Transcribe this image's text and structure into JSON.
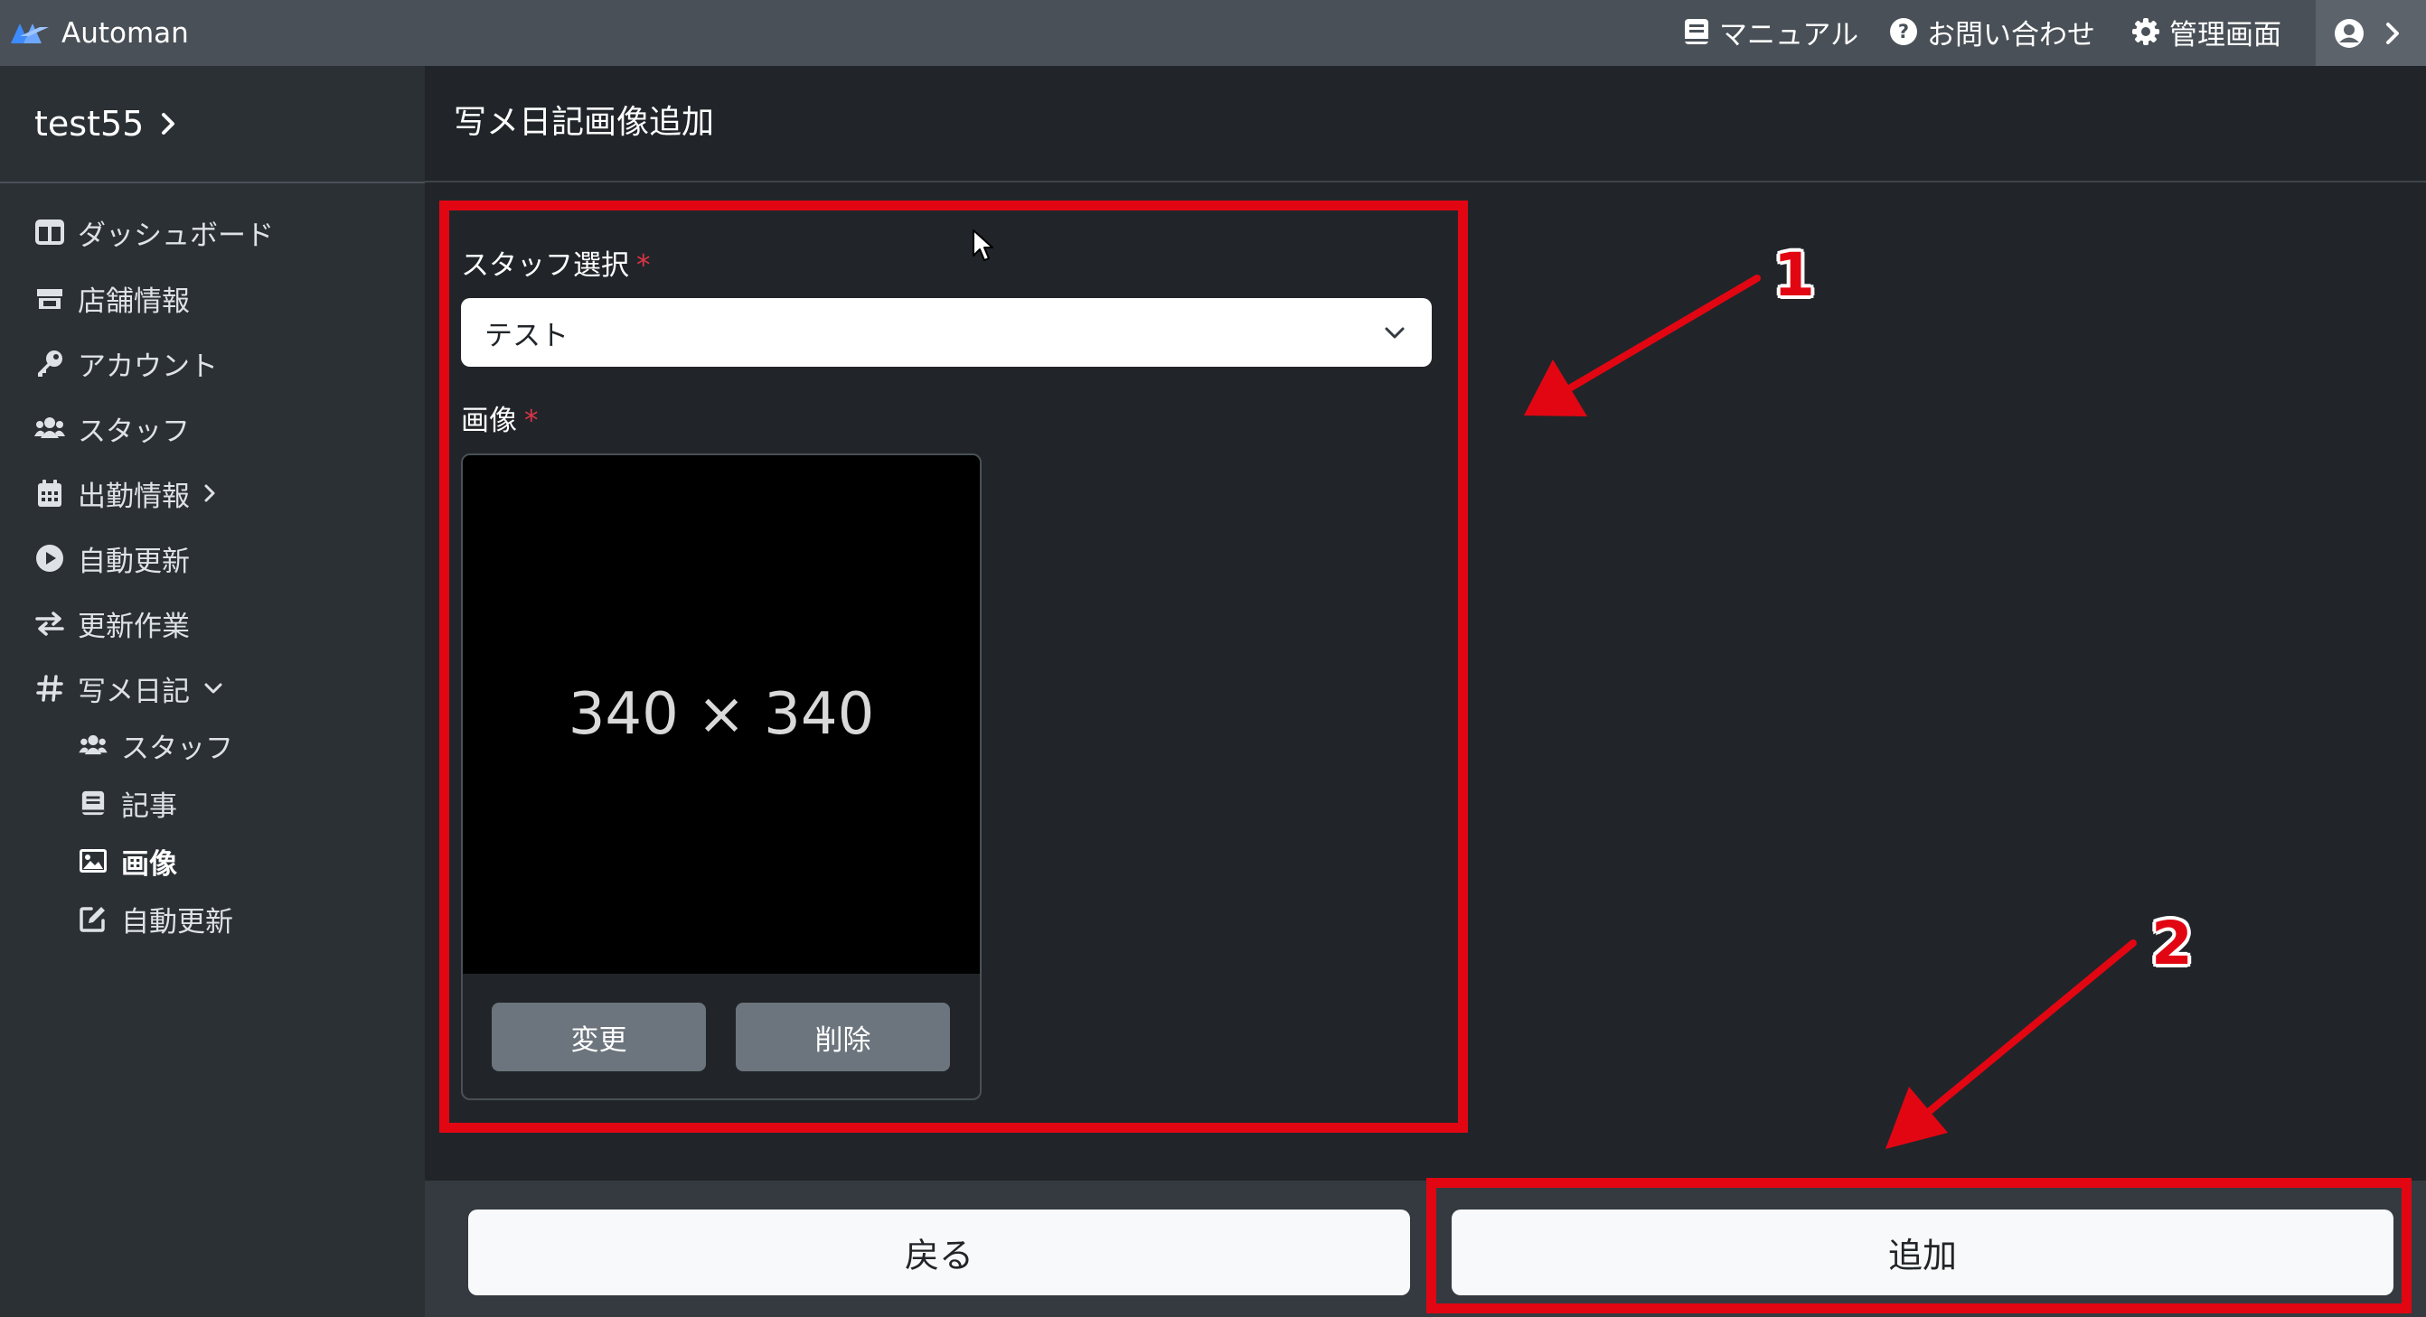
{
  "topbar": {
    "app_name": "Automan",
    "manual": "マニュアル",
    "contact": "お問い合わせ",
    "admin": "管理画面"
  },
  "sidebar": {
    "store_name": "test55",
    "items": [
      {
        "label": "ダッシュボード",
        "icon": "columns-icon"
      },
      {
        "label": "店舗情報",
        "icon": "store-icon"
      },
      {
        "label": "アカウント",
        "icon": "key-icon"
      },
      {
        "label": "スタッフ",
        "icon": "users-icon"
      },
      {
        "label": "出勤情報",
        "icon": "calendar-icon"
      },
      {
        "label": "自動更新",
        "icon": "play-circle-icon"
      },
      {
        "label": "更新作業",
        "icon": "exchange-icon"
      },
      {
        "label": "写メ日記",
        "icon": "hashtag-icon"
      }
    ],
    "sub_items": [
      {
        "label": "スタッフ",
        "icon": "users-icon"
      },
      {
        "label": "記事",
        "icon": "book-icon"
      },
      {
        "label": "画像",
        "icon": "image-icon",
        "active": true
      },
      {
        "label": "自動更新",
        "icon": "edit-icon"
      }
    ]
  },
  "page": {
    "title": "写メ日記画像追加"
  },
  "form": {
    "staff_label": "スタッフ選択",
    "required_mark": "*",
    "staff_value": "テスト",
    "image_label": "画像",
    "image_placeholder": "340 × 340",
    "change_button": "変更",
    "delete_button": "削除"
  },
  "footer": {
    "back_button": "戻る",
    "add_button": "追加"
  },
  "annotations": {
    "label_1": "1",
    "label_2": "2",
    "color": "#e20613"
  }
}
